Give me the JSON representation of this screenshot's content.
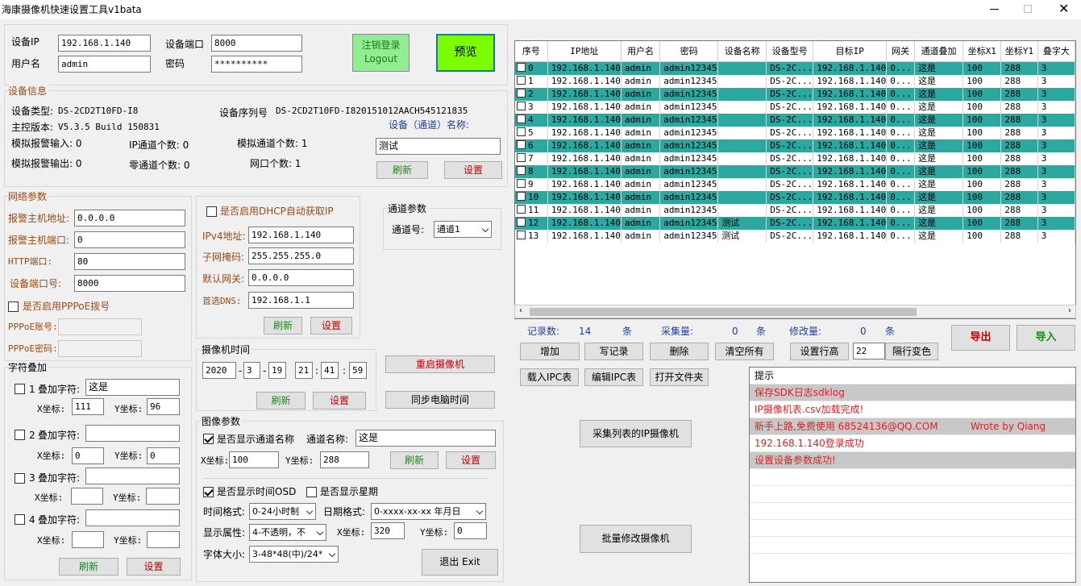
{
  "window": {
    "title": "海康摄像机快速设置工具v1bata"
  },
  "login": {
    "ip_label": "设备IP",
    "ip_value": "192.168.1.140",
    "port_label": "设备端口",
    "port_value": "8000",
    "user_label": "用户名",
    "user_value": "admin",
    "pwd_label": "密码",
    "pwd_value": "**********",
    "logout_label": "注销登录\nLogout",
    "preview_label": "预览"
  },
  "device_info": {
    "title": "设备信息",
    "type_label": "设备类型:",
    "type_value": "DS-2CD2T10FD-I8",
    "serial_label": "设备序列号",
    "serial_value": "DS-2CD2T10FD-I820151012AACH545121835",
    "fw_label": "主控版本:",
    "fw_value": "V5.3.5 Build 150831",
    "alarm_in": "模拟报警输入: 0",
    "ip_ch": "IP通道个数: 0",
    "analog_ch": "模拟通道个数: 1",
    "alarm_out": "模拟报警输出: 0",
    "zero_ch": "零通道个数: 0",
    "net_port": "网口个数: 1",
    "name_label": "设备（通道）名称:",
    "name_value": "测试",
    "refresh": "刷新",
    "set": "设置"
  },
  "network": {
    "title": "网络参数",
    "alarm_host_label": "报警主机地址:",
    "alarm_host_value": "0.0.0.0",
    "alarm_port_label": "报警主机端口:",
    "alarm_port_value": "0",
    "http_label": "HTTP端口:",
    "http_value": "80",
    "devport_label": "设备端口号:",
    "devport_value": "8000",
    "pppoe_label": "是否启用PPPoE拨号",
    "pppoe_acc_label": "PPPoE账号:",
    "pppoe_pwd_label": "PPPoE密码:",
    "dhcp_label": "是否启用DHCP自动获取IP",
    "ipv4_label": "IPv4地址:",
    "ipv4_value": "192.168.1.140",
    "mask_label": "子网掩码:",
    "mask_value": "255.255.255.0",
    "gw_label": "默认网关:",
    "gw_value": "0.0.0.0",
    "dns_label": "首选DNS:",
    "dns_value": "192.168.1.1",
    "refresh": "刷新",
    "set": "设置"
  },
  "channel": {
    "title": "通道参数",
    "label": "通道号:",
    "value": "通道1"
  },
  "osd": {
    "title": "字符叠加",
    "items": [
      {
        "n": "1",
        "label": "叠加字符:",
        "text": "这是",
        "x": "111",
        "y": "96"
      },
      {
        "n": "2",
        "label": "叠加字符:",
        "text": "",
        "x": "0",
        "y": "0"
      },
      {
        "n": "3",
        "label": "叠加字符:",
        "text": "",
        "x": "",
        "y": ""
      },
      {
        "n": "4",
        "label": "叠加字符:",
        "text": "",
        "x": "",
        "y": ""
      }
    ],
    "x_label": "X坐标:",
    "y_label": "Y坐标:",
    "refresh": "刷新",
    "set": "设置"
  },
  "camtime": {
    "title": "摄像机时间",
    "year": "2020",
    "month": "3",
    "day": "19",
    "hour": "21",
    "minute": "41",
    "second": "59",
    "dash": "-",
    "colon": ":",
    "refresh": "刷新",
    "set": "设置",
    "reboot": "重启摄像机",
    "sync": "同步电脑时间"
  },
  "image": {
    "title": "图像参数",
    "show_name_label": "是否显示通道名称",
    "ch_name_label": "通道名称:",
    "ch_name_value": "这是",
    "x_label": "X坐标:",
    "x_value": "100",
    "y_label": "Y坐标:",
    "y_value": "288",
    "refresh": "刷新",
    "set": "设置",
    "show_time_label": "是否显示时间OSD",
    "show_week_label": "是否显示星期",
    "time_fmt_label": "时间格式:",
    "time_fmt_value": "0-24小时制",
    "date_fmt_label": "日期格式:",
    "date_fmt_value": "0-xxxx-xx-xx 年月日",
    "attr_label": "显示属性:",
    "attr_value": "4-不透明，不",
    "x2_value": "320",
    "y2_value": "0",
    "font_label": "字体大小:",
    "font_value": "3-48*48(中)/24*",
    "exit": "退出 Exit"
  },
  "table": {
    "columns": [
      "序号",
      "IP地址",
      "用户名",
      "密码",
      "设备名称",
      "设备型号",
      "目标IP",
      "网关",
      "通道叠加",
      "坐标X1",
      "坐标Y1",
      "叠字大"
    ],
    "rows": [
      [
        "0",
        "192.168.1.140",
        "admin",
        "admin12345",
        "",
        "DS-2C...",
        "192.168.1.140",
        "0...",
        "这是",
        "100",
        "288",
        "3"
      ],
      [
        "1",
        "192.168.1.140",
        "admin",
        "admin12345",
        "",
        "DS-2C...",
        "192.168.1.140",
        "0...",
        "这是",
        "100",
        "288",
        "3"
      ],
      [
        "2",
        "192.168.1.140",
        "admin",
        "admin12345",
        "",
        "DS-2C...",
        "192.168.1.140",
        "0...",
        "这是",
        "100",
        "288",
        "3"
      ],
      [
        "3",
        "192.168.1.140",
        "admin",
        "admin12345",
        "",
        "DS-2C...",
        "192.168.1.140",
        "0...",
        "这是",
        "100",
        "288",
        "3"
      ],
      [
        "4",
        "192.168.1.140",
        "admin",
        "admin12345",
        "",
        "DS-2C...",
        "192.168.1.140",
        "0...",
        "这是",
        "100",
        "288",
        "3"
      ],
      [
        "5",
        "192.168.1.140",
        "admin",
        "admin12345",
        "",
        "DS-2C...",
        "192.168.1.140",
        "0...",
        "这是",
        "100",
        "288",
        "3"
      ],
      [
        "6",
        "192.168.1.140",
        "admin",
        "admin12345",
        "",
        "DS-2C...",
        "192.168.1.140",
        "0...",
        "这是",
        "100",
        "288",
        "3"
      ],
      [
        "7",
        "192.168.1.140",
        "admin",
        "admin12345",
        "",
        "DS-2C...",
        "192.168.1.140",
        "0...",
        "这是",
        "100",
        "288",
        "3"
      ],
      [
        "8",
        "192.168.1.140",
        "admin",
        "admin12345",
        "",
        "DS-2C...",
        "192.168.1.140",
        "0...",
        "这是",
        "100",
        "288",
        "3"
      ],
      [
        "9",
        "192.168.1.140",
        "admin",
        "admin12345",
        "",
        "DS-2C...",
        "192.168.1.140",
        "0...",
        "这是",
        "100",
        "288",
        "3"
      ],
      [
        "10",
        "192.168.1.140",
        "admin",
        "admin12345",
        "",
        "DS-2C...",
        "192.168.1.140",
        "0...",
        "这是",
        "100",
        "288",
        "3"
      ],
      [
        "11",
        "192.168.1.140",
        "admin",
        "admin12345",
        "",
        "DS-2C...",
        "192.168.1.140",
        "0...",
        "这是",
        "100",
        "288",
        "3"
      ],
      [
        "12",
        "192.168.1.140",
        "admin",
        "admin12345",
        "测试",
        "DS-2C...",
        "192.168.1.140",
        "0...",
        "这是",
        "100",
        "288",
        "3"
      ],
      [
        "13",
        "192.168.1.140",
        "admin",
        "admin12345",
        "测试",
        "DS-2C...",
        "192.168.1.140",
        "0...",
        "这是",
        "100",
        "288",
        "3"
      ]
    ],
    "colors": {
      "highlight": "#2ba8a0"
    }
  },
  "stats": {
    "records_label": "记录数:",
    "records_value": "14",
    "unit": "条",
    "collect_label": "采集量:",
    "collect_value": "0",
    "modify_label": "修改量:",
    "modify_value": "0"
  },
  "actions": {
    "add": "增加",
    "write": "写记录",
    "delete": "删除",
    "clear": "清空所有",
    "row_height": "设置行高",
    "row_height_value": "22",
    "alt_color": "隔行变色",
    "export": "导出",
    "import": "导入",
    "load": "载入IPC表",
    "edit": "编辑IPC表",
    "open_folder": "打开文件夹",
    "collect": "采集列表的IP摄像机",
    "batch": "批量修改摄像机"
  },
  "log": {
    "title": "提示",
    "lines": [
      "保存SDK日志sdklog",
      "IP摄像机表.csv加载完成!",
      "新手上路,免费使用 68524136@QQ.COM",
      "192.168.1.140登录成功",
      "设置设备参数成功!"
    ],
    "credit": "Wrote by Qiang"
  }
}
